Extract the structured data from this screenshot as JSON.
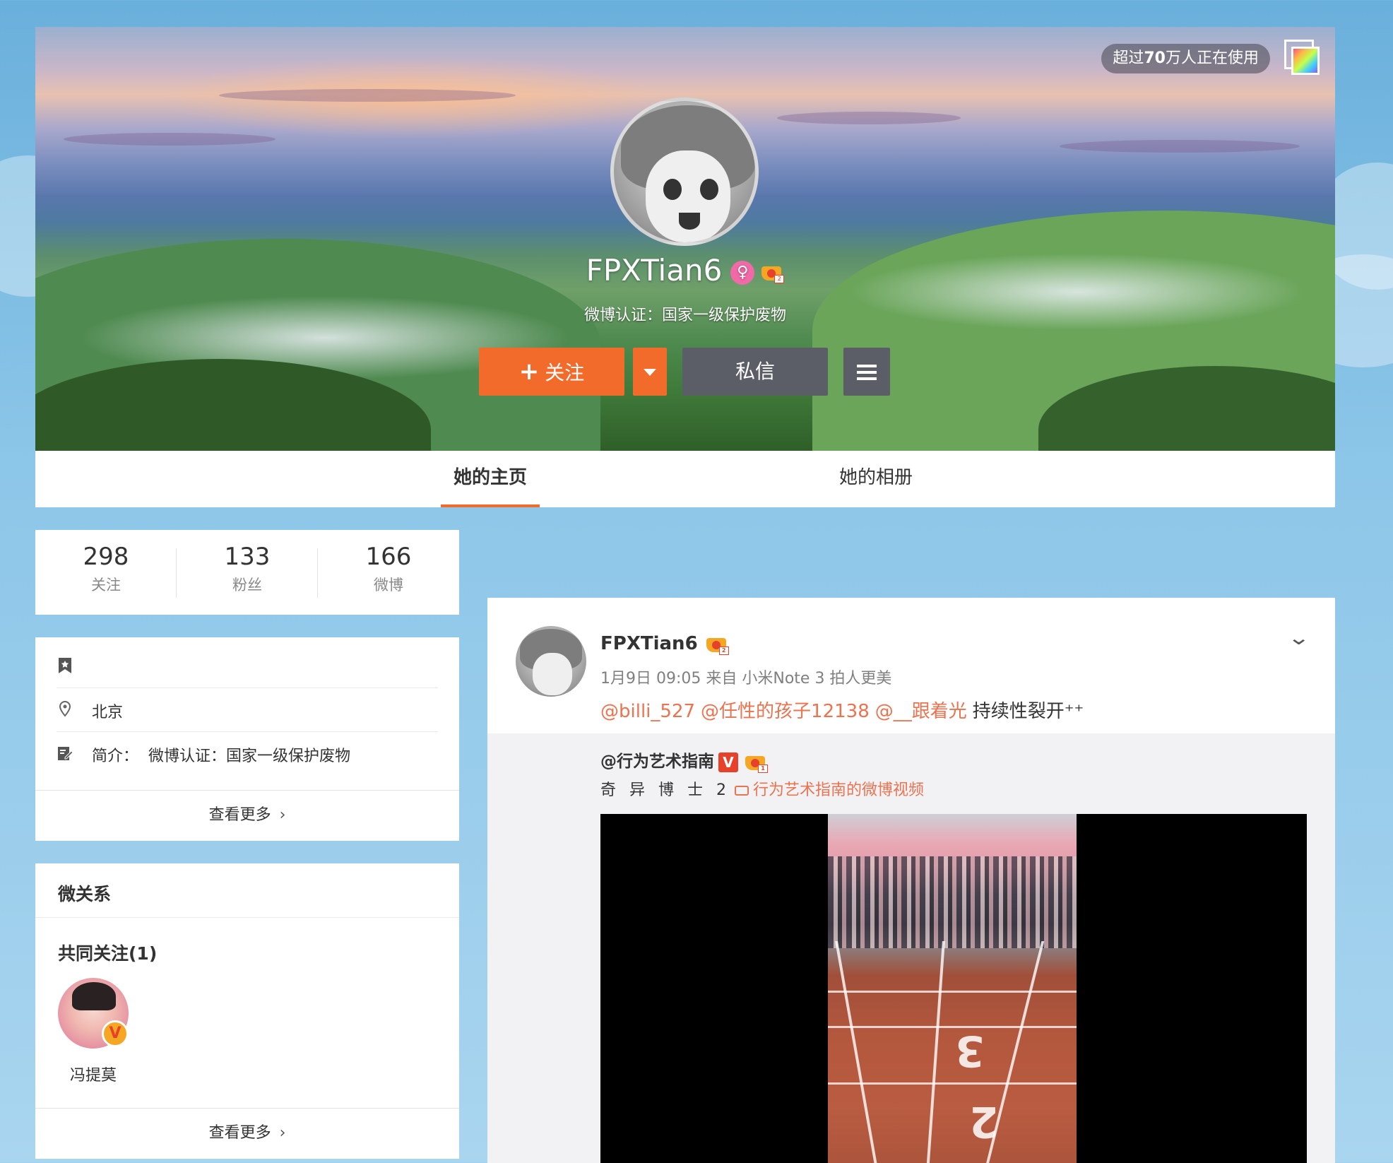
{
  "cover": {
    "users_pill_prefix": "超过",
    "users_pill_count": "70",
    "users_pill_suffix": "万人正在使用",
    "profile_name": "FPXTian6",
    "verification": "微博认证：国家一级保护废物"
  },
  "actions": {
    "follow_label": "关注",
    "message_label": "私信"
  },
  "tabs": [
    {
      "label": "她的主页",
      "active": true
    },
    {
      "label": "她的相册",
      "active": false
    }
  ],
  "stats": [
    {
      "value": "298",
      "label": "关注"
    },
    {
      "value": "133",
      "label": "粉丝"
    },
    {
      "value": "166",
      "label": "微博"
    }
  ],
  "info": {
    "location": "北京",
    "bio_label": "简介：",
    "bio_value": "微博认证：国家一级保护废物",
    "more_label": "查看更多"
  },
  "relations": {
    "title": "微关系",
    "common_follow": "共同关注(1)",
    "friend_name": "冯提莫",
    "more_label": "查看更多"
  },
  "feed": {
    "author": "FPXTian6",
    "meta": "1月9日 09:05 来自 小米Note 3 拍人更美",
    "mentions": [
      "@billi_527",
      "@任性的孩子12138",
      "@__跟着光"
    ],
    "text": "持续性裂开⁺⁺",
    "repost_author": "@行为艺术指南",
    "repost_text": "奇 异 博 士 2",
    "video_link": "行为艺术指南的微博视频"
  },
  "colors": {
    "accent": "#f26b2a",
    "mention": "#eb7350",
    "dark_button": "#5b5e66"
  },
  "icons": [
    "skin-icon",
    "female-icon",
    "crown-icon",
    "dropdown-icon",
    "menu-icon",
    "bookmark-icon",
    "location-icon",
    "edit-icon",
    "chevron-right-icon",
    "chevron-down-icon",
    "verified-v-icon",
    "video-icon"
  ]
}
